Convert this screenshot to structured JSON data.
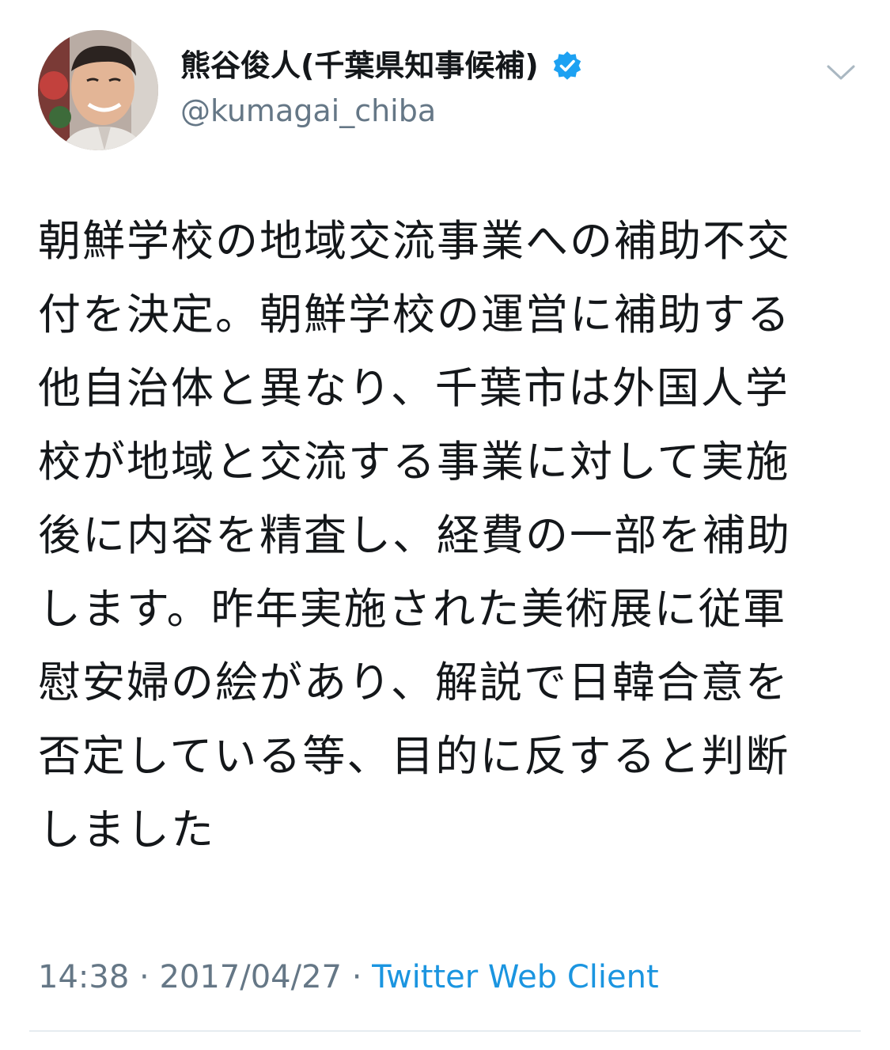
{
  "author": {
    "display_name": "熊谷俊人(千葉県知事候補)",
    "handle": "@kumagai_chiba",
    "verified": true
  },
  "tweet": {
    "text": "朝鮮学校の地域交流事業への補助不交付を決定。朝鮮学校の運営に補助する他自治体と異なり、千葉市は外国人学校が地域と交流する事業に対して実施後に内容を精査し、経費の一部を補助します。昨年実施された美術展に従軍慰安婦の絵があり、解説で日韓合意を否定している等、目的に反すると判断しました",
    "time": "14:38",
    "separator": "·",
    "date": "2017/04/27",
    "source": "Twitter Web Client"
  },
  "icons": {
    "verified": "verified-badge-icon",
    "caret": "chevron-down-icon"
  },
  "colors": {
    "text": "#14171a",
    "secondary": "#657786",
    "link": "#1b95e0",
    "verified": "#1da1f2",
    "divider": "#e6ecf0"
  }
}
